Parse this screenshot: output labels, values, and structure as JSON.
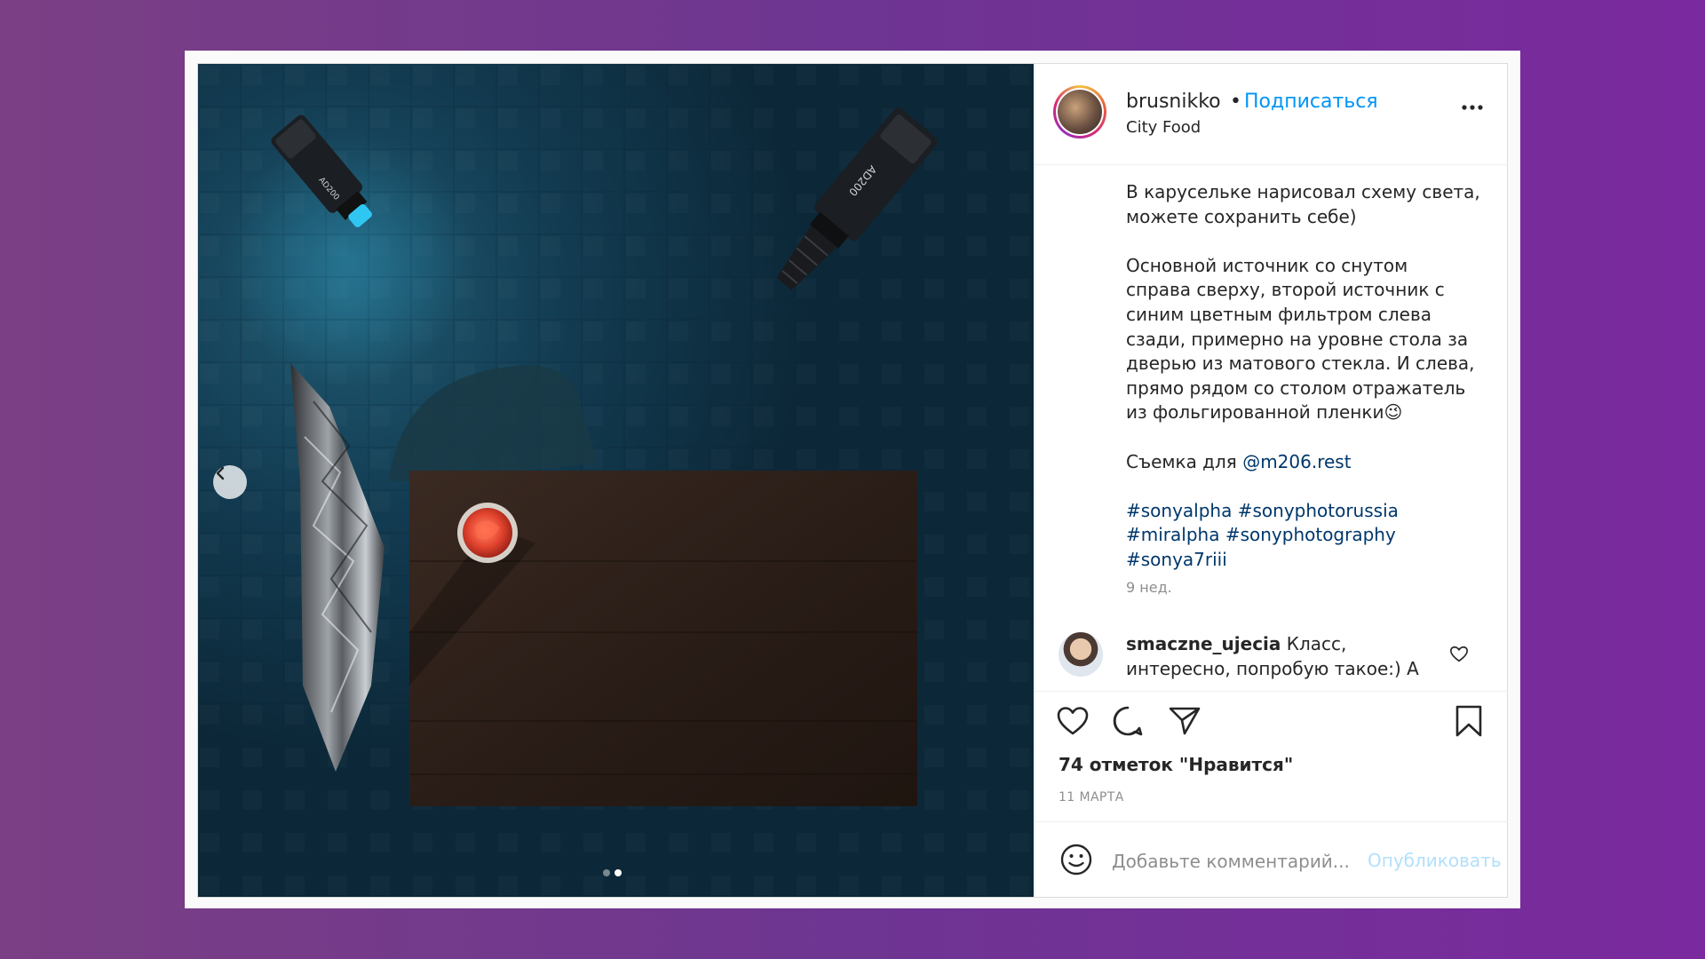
{
  "post": {
    "username": "brusnikko",
    "separator": "•",
    "follow_label": "Подписаться",
    "location": "City Food",
    "caption_paragraphs": [
      "В карусельке нарисовал схему света,\nможете сохранить себе)",
      "Основной источник со снутом\nсправа сверху, второй источник с\nсиним цветным фильтром слева\nсзади, примерно на уровне стола за\nдверью из матового стекла. И слева,\nпрямо рядом со столом отражатель\nиз фольгированной пленки"
    ],
    "caption_emoji": "😉",
    "shoot_prefix": "Съемка для ",
    "shoot_mention": "@m206.rest",
    "hashtags_line1": "#sonyalpha #sonyphotorussia",
    "hashtags_line2": "#miralpha #sonyphotography",
    "hashtags_line3": "#sonya7riii",
    "time_ago": "9 нед.",
    "comment": {
      "user": "smaczne_ujecia",
      "text": " Класс, интересно, попробую такое:) А"
    },
    "likes": "74 отметок \"Нравится\"",
    "date": "11 МАРТА",
    "comment_placeholder": "Добавьте комментарий...",
    "publish_label": "Опубликовать"
  },
  "media": {
    "light_left_label": "AD200",
    "light_right_label": "AD200",
    "carousel_total": 2,
    "carousel_active": 2
  },
  "colors": {
    "follow_blue": "#0095f6",
    "link_blue": "#00376b",
    "publish_disabled": "#b2dffc",
    "background_purple": "#7a3f84"
  }
}
